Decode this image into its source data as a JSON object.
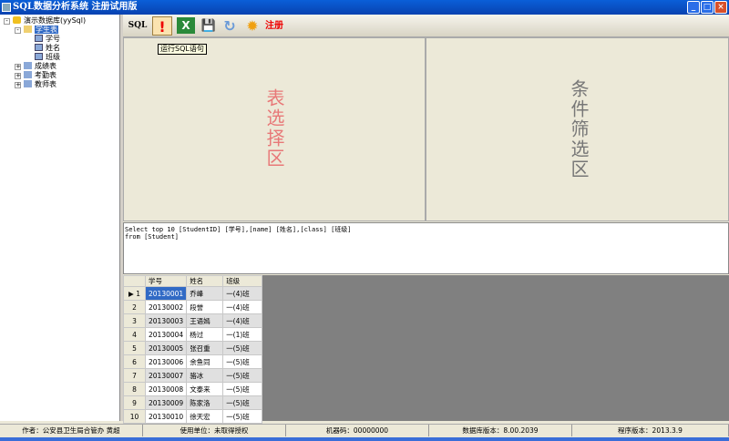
{
  "window": {
    "title": "SQL数据分析系统 注册试用版",
    "minimize": "_",
    "maximize": "□",
    "close": "×"
  },
  "tree": {
    "root": "演示数据库(yySql)",
    "tables": [
      {
        "name": "学生表",
        "fields": [
          "学号",
          "姓名",
          "班级"
        ]
      },
      {
        "name": "成绩表"
      },
      {
        "name": "考勤表"
      },
      {
        "name": "教师表"
      }
    ]
  },
  "toolbar": {
    "sql": "SQL",
    "run": "!",
    "excel": "X",
    "save": "💾",
    "refresh": "↻",
    "register": "注册",
    "tooltip": "运行SQL语句"
  },
  "panes": {
    "table_select": "表选择区",
    "condition_filter": "条件筛选区"
  },
  "sql_text": "Select top 10 [StudentID] [学号],[name] [姓名],[class] [班级]\nfrom [Student]",
  "grid": {
    "columns": [
      "学号",
      "姓名",
      "班级"
    ],
    "rows": [
      [
        "1",
        "20130001",
        "乔峰",
        "一(4)班"
      ],
      [
        "2",
        "20130002",
        "段誉",
        "一(4)班"
      ],
      [
        "3",
        "20130003",
        "王语嫣",
        "一(4)班"
      ],
      [
        "4",
        "20130004",
        "杨过",
        "一(1)班"
      ],
      [
        "5",
        "20130005",
        "张召重",
        "一(5)班"
      ],
      [
        "6",
        "20130006",
        "余鱼同",
        "一(5)班"
      ],
      [
        "7",
        "20130007",
        "骆冰",
        "一(5)班"
      ],
      [
        "8",
        "20130008",
        "文泰来",
        "一(5)班"
      ],
      [
        "9",
        "20130009",
        "陈家洛",
        "一(5)班"
      ],
      [
        "10",
        "20130010",
        "徐天宏",
        "一(5)班"
      ]
    ]
  },
  "status": {
    "author": "作者：公安县卫生局合管办 黄超",
    "unit": "使用单位：未取得授权",
    "machine": "机器码：00000000",
    "db_version": "数据库版本：8.00.2039",
    "app_version": "程序版本：2013.3.9"
  }
}
